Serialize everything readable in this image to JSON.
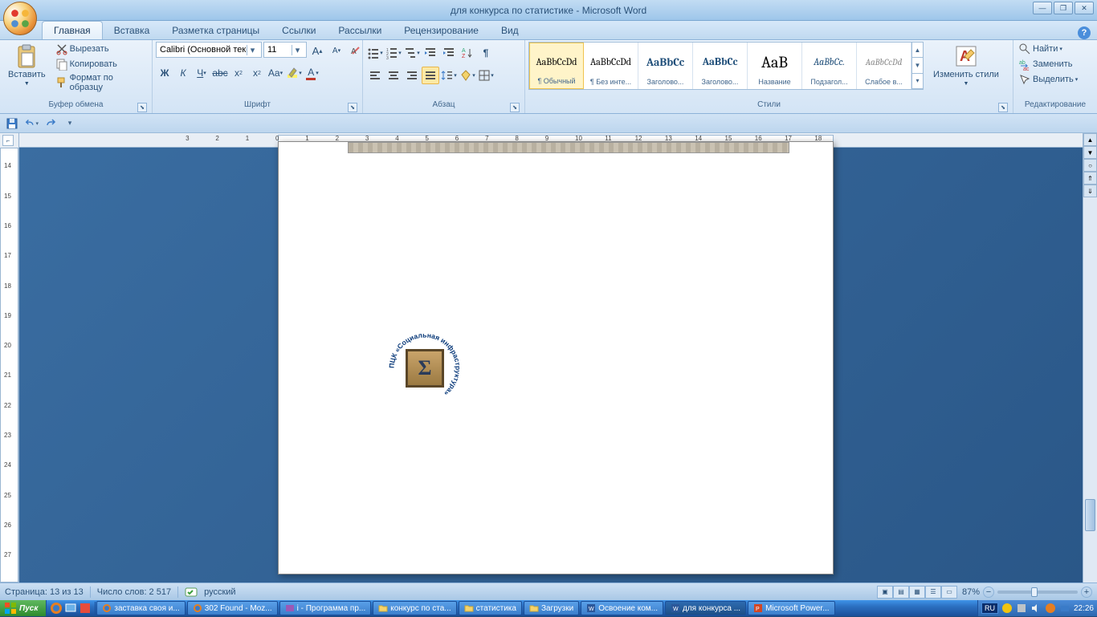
{
  "title": "для конкурса по статистике - Microsoft Word",
  "tabs": [
    "Главная",
    "Вставка",
    "Разметка страницы",
    "Ссылки",
    "Рассылки",
    "Рецензирование",
    "Вид"
  ],
  "active_tab_index": 0,
  "clipboard": {
    "paste": "Вставить",
    "cut": "Вырезать",
    "copy": "Копировать",
    "format_painter": "Формат по образцу",
    "group": "Буфер обмена"
  },
  "font": {
    "name": "Calibri (Основной текст",
    "size": "11",
    "group": "Шрифт"
  },
  "paragraph": {
    "group": "Абзац"
  },
  "styles": {
    "group": "Стили",
    "change": "Изменить стили",
    "items": [
      {
        "sample": "AaBbCcDd",
        "label": "¶ Обычный",
        "size": "12px",
        "color": "#222",
        "family": "Calibri"
      },
      {
        "sample": "AaBbCcDd",
        "label": "¶ Без инте...",
        "size": "12px",
        "color": "#222",
        "family": "Calibri"
      },
      {
        "sample": "AaBbCc",
        "label": "Заголово...",
        "size": "14px",
        "color": "#1f4e79",
        "family": "Cambria",
        "bold": true
      },
      {
        "sample": "AaBbCc",
        "label": "Заголово...",
        "size": "13px",
        "color": "#1f4e79",
        "family": "Cambria",
        "bold": true
      },
      {
        "sample": "AaB",
        "label": "Название",
        "size": "20px",
        "color": "#222",
        "family": "Cambria"
      },
      {
        "sample": "AaBbCc.",
        "label": "Подзагол...",
        "size": "12px",
        "color": "#1f4e79",
        "family": "Cambria",
        "italic": true
      },
      {
        "sample": "AaBbCcDd",
        "label": "Слабое в...",
        "size": "11px",
        "color": "#8a8a8a",
        "family": "Calibri",
        "italic": true
      }
    ]
  },
  "editing": {
    "group": "Редактирование",
    "find": "Найти",
    "replace": "Заменить",
    "select": "Выделить"
  },
  "status": {
    "page": "Страница: 13 из 13",
    "words": "Число слов: 2 517",
    "lang": "русский",
    "zoom": "87%"
  },
  "logo_text": "ПЦК «Социальная инфраструктура»",
  "taskbar": {
    "start": "Пуск",
    "items": [
      {
        "label": "заставка своя и...",
        "icon": "firefox"
      },
      {
        "label": "302 Found - Moz...",
        "icon": "firefox"
      },
      {
        "label": "i - Программа пр...",
        "icon": "image"
      },
      {
        "label": "конкурс по ста...",
        "icon": "folder"
      },
      {
        "label": "статистика",
        "icon": "folder"
      },
      {
        "label": "Загрузки",
        "icon": "folder"
      },
      {
        "label": "Освоение   ком...",
        "icon": "word"
      },
      {
        "label": "для конкурса ...",
        "icon": "word",
        "active": true
      },
      {
        "label": "Microsoft Power...",
        "icon": "ppt"
      }
    ],
    "lang": "RU",
    "time": "22:26"
  }
}
